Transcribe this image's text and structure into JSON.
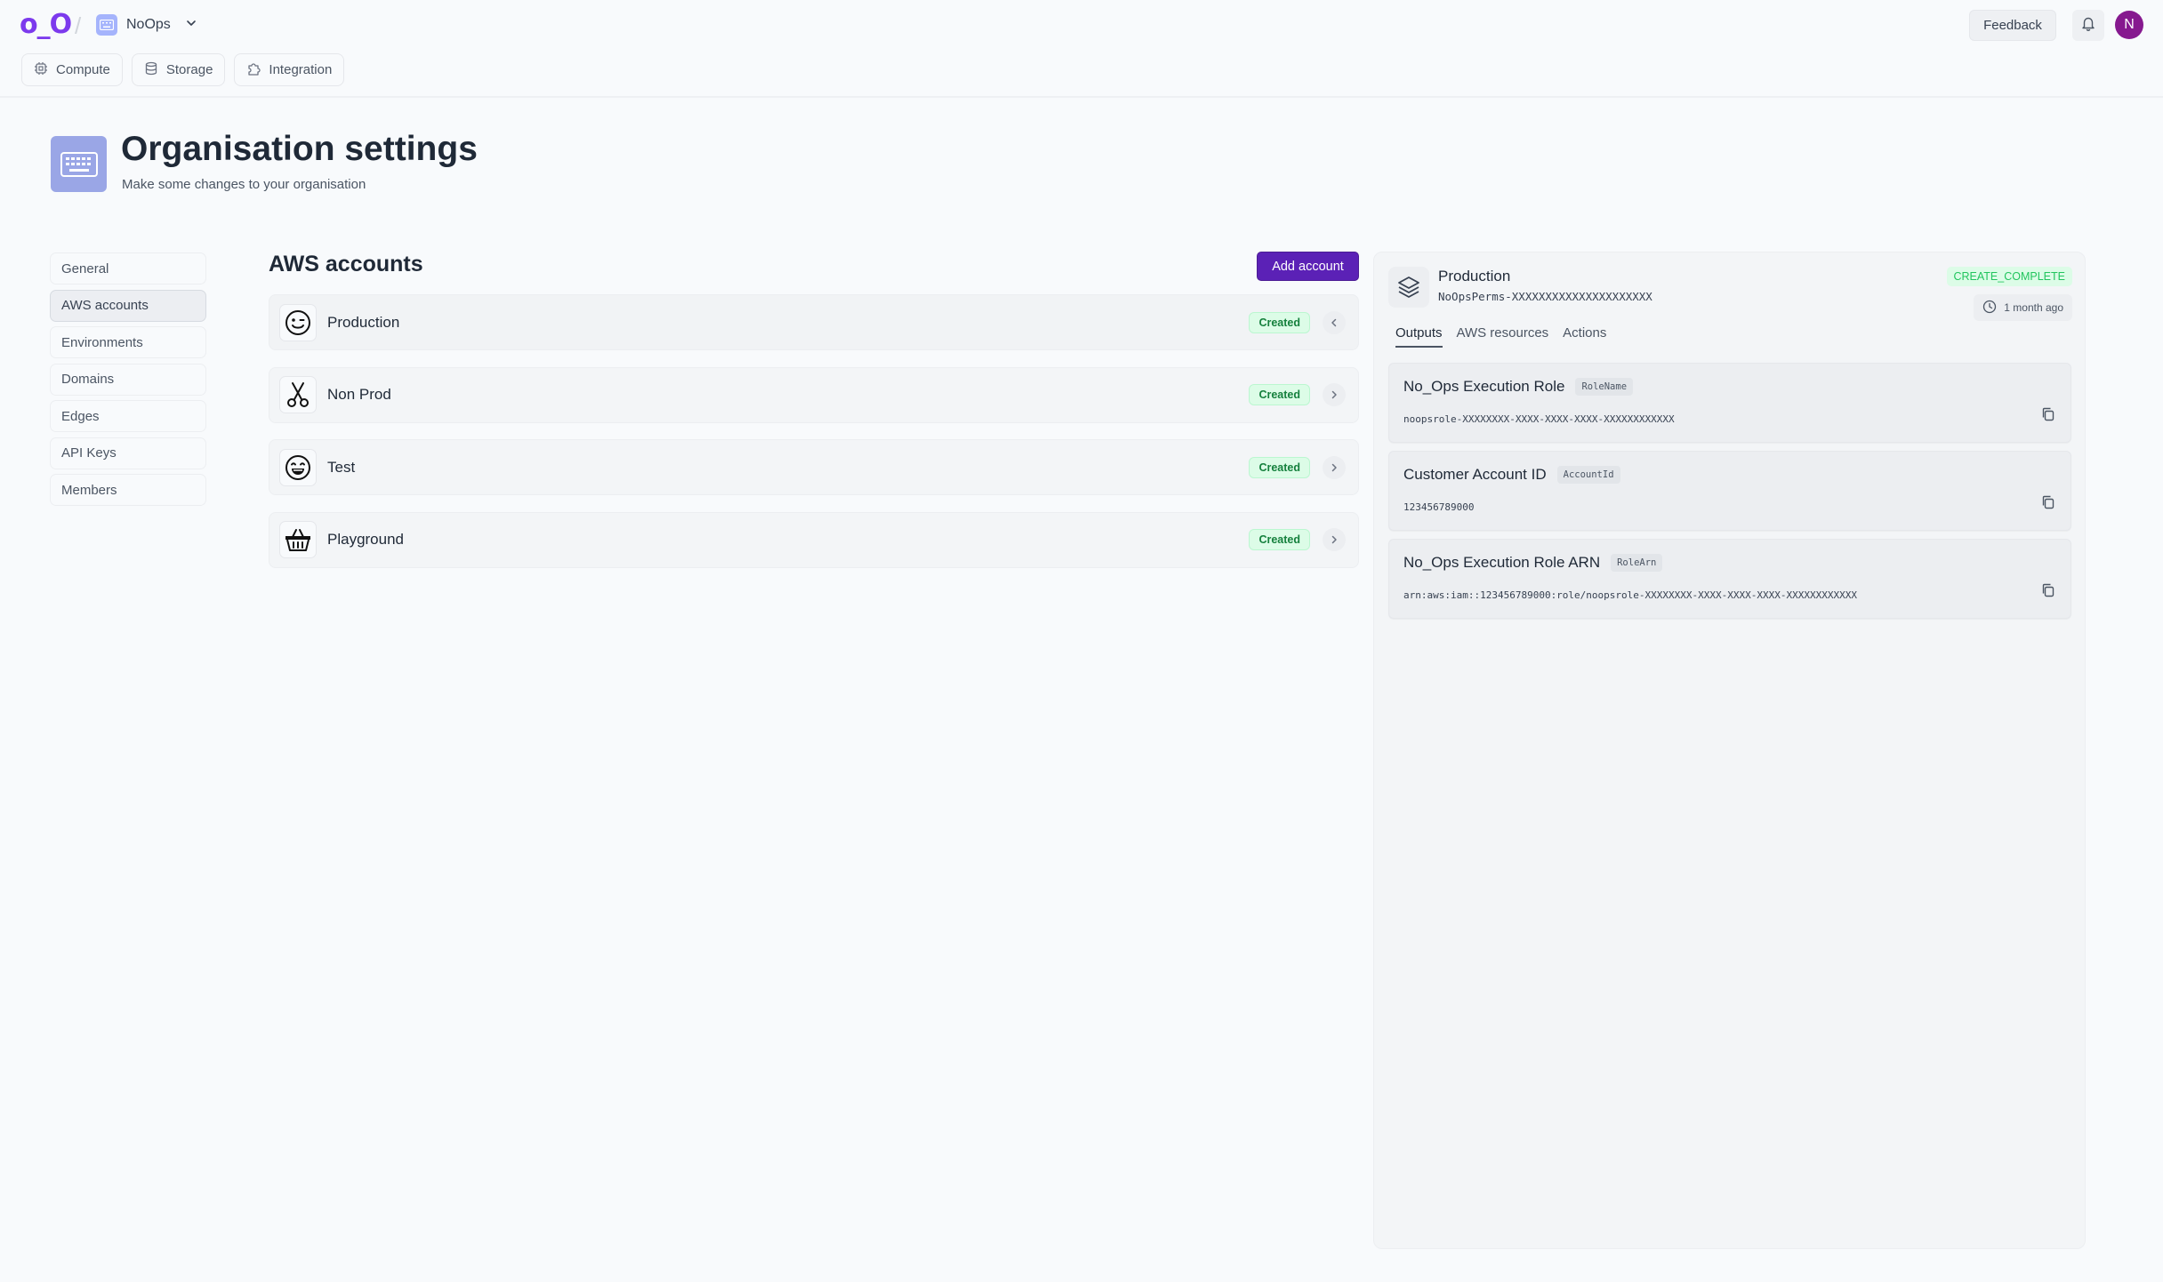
{
  "app": {
    "logo_text": "o_O",
    "org_name": "NoOps",
    "nav": [
      {
        "label": "Compute",
        "icon": "cpu-icon"
      },
      {
        "label": "Storage",
        "icon": "database-icon"
      },
      {
        "label": "Integration",
        "icon": "puzzle-icon"
      }
    ],
    "feedback_label": "Feedback",
    "avatar_initial": "N",
    "accent_color": "#5b21b6"
  },
  "page": {
    "title": "Organisation settings",
    "subtitle": "Make some changes to your organisation"
  },
  "settings_menu": [
    {
      "label": "General",
      "active": false
    },
    {
      "label": "AWS accounts",
      "active": true
    },
    {
      "label": "Environments",
      "active": false
    },
    {
      "label": "Domains",
      "active": false
    },
    {
      "label": "Edges",
      "active": false
    },
    {
      "label": "API Keys",
      "active": false
    },
    {
      "label": "Members",
      "active": false
    }
  ],
  "accounts_section": {
    "title": "AWS accounts",
    "add_label": "Add account",
    "accounts": [
      {
        "name": "Production",
        "status": "Created",
        "icon": "wink-face-icon",
        "selected": true
      },
      {
        "name": "Non Prod",
        "status": "Created",
        "icon": "scissors-icon",
        "selected": false
      },
      {
        "name": "Test",
        "status": "Created",
        "icon": "laughing-face-icon",
        "selected": false
      },
      {
        "name": "Playground",
        "status": "Created",
        "icon": "basket-icon",
        "selected": false
      }
    ]
  },
  "detail": {
    "name": "Production",
    "stack": "NoOpsPerms-XXXXXXXXXXXXXXXXXXXXX",
    "status": "CREATE_COMPLETE",
    "time": "1 month ago",
    "tabs": [
      {
        "label": "Outputs",
        "active": true
      },
      {
        "label": "AWS resources",
        "active": false
      },
      {
        "label": "Actions",
        "active": false
      }
    ],
    "outputs": [
      {
        "label": "No_Ops Execution Role",
        "key": "RoleName",
        "value": "noopsrole-XXXXXXXX-XXXX-XXXX-XXXX-XXXXXXXXXXXX"
      },
      {
        "label": "Customer Account ID",
        "key": "AccountId",
        "value": "123456789000"
      },
      {
        "label": "No_Ops Execution Role ARN",
        "key": "RoleArn",
        "value": "arn:aws:iam::123456789000:role/noopsrole-XXXXXXXX-XXXX-XXXX-XXXX-XXXXXXXXXXXX"
      }
    ]
  }
}
